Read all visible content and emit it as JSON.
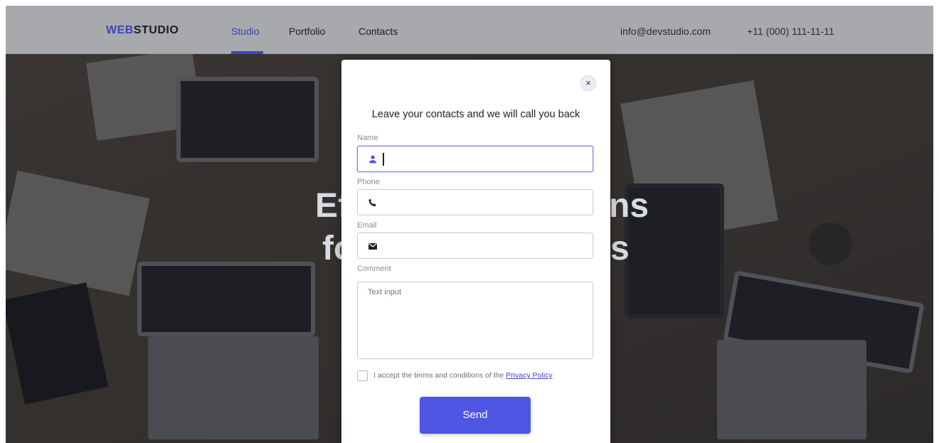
{
  "header": {
    "logo_part1": "WEB",
    "logo_part2": "STUDIO",
    "nav": [
      {
        "label": "Studio",
        "active": true
      },
      {
        "label": "Portfolio",
        "active": false
      },
      {
        "label": "Contacts",
        "active": false
      }
    ],
    "email": "info@devstudio.com",
    "phone": "+11 (000) 111-11-11"
  },
  "hero": {
    "line1_left": "Ef",
    "line1_right": "ns",
    "line2_left": "fo",
    "line2_right": "s"
  },
  "modal": {
    "close_symbol": "×",
    "title": "Leave your contacts and we will call you back",
    "name_label": "Name",
    "phone_label": "Phone",
    "email_label": "Email",
    "comment_label": "Comment",
    "comment_placeholder": "Text input",
    "terms_text": "I accept the terms and conditions of the",
    "privacy_link": "Privacy Policy",
    "send_label": "Send"
  },
  "colors": {
    "accent": "#4e55e3",
    "header_bg": "#a7a9ad",
    "logo_accent": "#3f45b5"
  },
  "icons": [
    "close-icon",
    "person-icon",
    "phone-icon",
    "mail-icon"
  ]
}
